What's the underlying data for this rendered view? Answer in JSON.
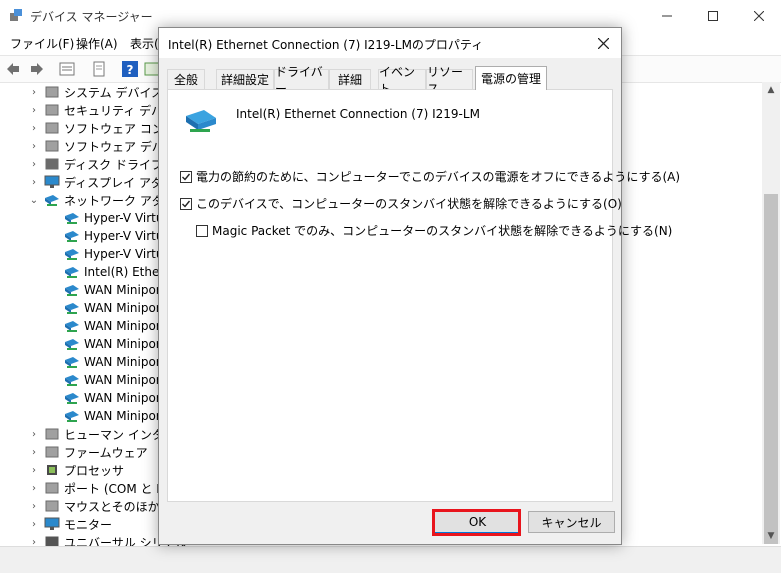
{
  "window": {
    "title": "デバイス マネージャー",
    "menu": [
      "ファイル(F)",
      "操作(A)",
      "表示("
    ]
  },
  "tree": [
    {
      "label": "システム デバイス",
      "indent": 0,
      "icon": "system-device-icon",
      "expander": "collapsed"
    },
    {
      "label": "セキュリティ デバイス",
      "indent": 0,
      "icon": "security-device-icon",
      "expander": "collapsed"
    },
    {
      "label": "ソフトウェア コンポーネ",
      "indent": 0,
      "icon": "software-component-icon",
      "expander": "collapsed"
    },
    {
      "label": "ソフトウェア デバイス",
      "indent": 0,
      "icon": "software-device-icon",
      "expander": "collapsed"
    },
    {
      "label": "ディスク ドライブ",
      "indent": 0,
      "icon": "disk-drive-icon",
      "expander": "collapsed"
    },
    {
      "label": "ディスプレイ アダプター",
      "indent": 0,
      "icon": "display-adapter-icon",
      "expander": "collapsed"
    },
    {
      "label": "ネットワーク アダプター",
      "indent": 0,
      "icon": "network-adapter-icon",
      "expander": "expanded"
    },
    {
      "label": "Hyper-V Virtua",
      "indent": 1,
      "icon": "network-adapter-icon",
      "expander": "none"
    },
    {
      "label": "Hyper-V Virtua",
      "indent": 1,
      "icon": "network-adapter-icon",
      "expander": "none"
    },
    {
      "label": "Hyper-V Virtua",
      "indent": 1,
      "icon": "network-adapter-icon",
      "expander": "none"
    },
    {
      "label": "Intel(R) Ethern",
      "indent": 1,
      "icon": "network-adapter-icon",
      "expander": "none"
    },
    {
      "label": "WAN Minipor",
      "indent": 1,
      "icon": "network-adapter-icon",
      "expander": "none"
    },
    {
      "label": "WAN Minipor",
      "indent": 1,
      "icon": "network-adapter-icon",
      "expander": "none"
    },
    {
      "label": "WAN Minipor",
      "indent": 1,
      "icon": "network-adapter-icon",
      "expander": "none"
    },
    {
      "label": "WAN Minipor",
      "indent": 1,
      "icon": "network-adapter-icon",
      "expander": "none"
    },
    {
      "label": "WAN Minipor",
      "indent": 1,
      "icon": "network-adapter-icon",
      "expander": "none"
    },
    {
      "label": "WAN Minipor",
      "indent": 1,
      "icon": "network-adapter-icon",
      "expander": "none"
    },
    {
      "label": "WAN Minipor",
      "indent": 1,
      "icon": "network-adapter-icon",
      "expander": "none"
    },
    {
      "label": "WAN Minipor",
      "indent": 1,
      "icon": "network-adapter-icon",
      "expander": "none"
    },
    {
      "label": "ヒューマン インターフェ",
      "indent": 0,
      "icon": "human-interface-icon",
      "expander": "collapsed"
    },
    {
      "label": "ファームウェア",
      "indent": 0,
      "icon": "firmware-icon",
      "expander": "collapsed"
    },
    {
      "label": "プロセッサ",
      "indent": 0,
      "icon": "processor-icon",
      "expander": "collapsed"
    },
    {
      "label": "ポート (COM と LPT",
      "indent": 0,
      "icon": "port-icon",
      "expander": "collapsed"
    },
    {
      "label": "マウスとそのほかのポ",
      "indent": 0,
      "icon": "mouse-icon",
      "expander": "collapsed"
    },
    {
      "label": "モニター",
      "indent": 0,
      "icon": "monitor-icon",
      "expander": "collapsed"
    },
    {
      "label": "ユニバーサル シリアル",
      "indent": 0,
      "icon": "usb-icon",
      "expander": "collapsed"
    }
  ],
  "dialog": {
    "title": "Intel(R) Ethernet Connection (7) I219-LMのプロパティ",
    "tabs": [
      "全般",
      "詳細設定",
      "ドライバー",
      "詳細",
      "イベント",
      "リソース",
      "電源の管理"
    ],
    "active_tab": "電源の管理",
    "device_name": "Intel(R) Ethernet Connection (7) I219-LM",
    "options": [
      {
        "label": "電力の節約のために、コンピューターでこのデバイスの電源をオフにできるようにする(A)",
        "checked": true
      },
      {
        "label": "このデバイスで、コンピューターのスタンバイ状態を解除できるようにする(O)",
        "checked": true
      },
      {
        "label": "Magic Packet でのみ、コンピューターのスタンバイ状態を解除できるようにする(N)",
        "checked": false
      }
    ],
    "ok_label": "OK",
    "cancel_label": "キャンセル"
  },
  "colors": {
    "highlight": "#e8141c",
    "accent": "#0078d7"
  }
}
